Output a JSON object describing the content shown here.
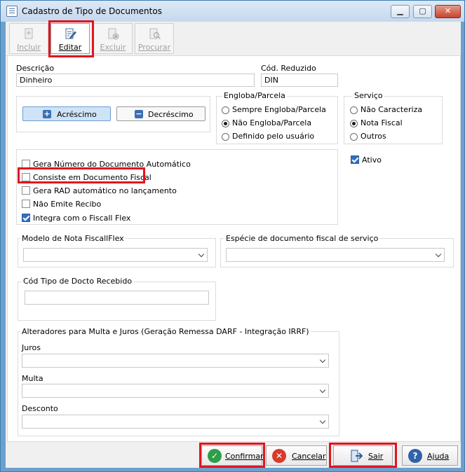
{
  "window": {
    "title": "Cadastro de Tipo de Documentos",
    "minimize": "▁",
    "maximize": "▢",
    "close": "✕"
  },
  "toolbar": {
    "incluir": "Incluir",
    "editar": "Editar",
    "excluir": "Excluir",
    "procurar": "Procurar"
  },
  "form": {
    "descricao_label": "Descrição",
    "descricao_value": "Dinheiro",
    "cod_reduzido_label": "Cód. Reduzido",
    "cod_reduzido_value": "DIN",
    "acrescimo": "Acréscimo",
    "decrescimo": "Decréscimo",
    "engloba": {
      "label": "Engloba/Parcela",
      "options": [
        "Sempre Engloba/Parcela",
        "Não Engloba/Parcela",
        "Definido pelo usuário"
      ],
      "selected": "Não Engloba/Parcela"
    },
    "servico": {
      "label": "Serviço",
      "options": [
        "Não Caracteriza",
        "Nota Fiscal",
        "Outros"
      ],
      "selected": "Nota Fiscal"
    },
    "ativo": "Ativo",
    "checks": [
      {
        "label": "Gera Número do Documento Automático",
        "checked": false
      },
      {
        "label": "Consiste em Documento Fiscal",
        "checked": false
      },
      {
        "label": "Gera RAD automático no lançamento",
        "checked": false
      },
      {
        "label": "Não Emite Recibo",
        "checked": false
      },
      {
        "label": "Integra com o Fiscall Flex",
        "checked": true
      }
    ],
    "modelo_nota_label": "Modelo de Nota FiscallFlex",
    "especie_label": "Espécie de documento fiscal de serviço",
    "cod_tipo_label": "Cód Tipo de Docto Recebido",
    "alteradores_label": "Alteradores para Multa e Juros (Geração Remessa DARF - Integração IRRF)",
    "juros_label": "Juros",
    "multa_label": "Multa",
    "desconto_label": "Desconto"
  },
  "buttons": {
    "confirmar": "Confirmar",
    "cancelar": "Cancelar",
    "sair": "Sair",
    "ajuda": "Ajuda"
  },
  "colors": {
    "highlight": "#e0141e",
    "accent": "#2f6fbf",
    "confirm": "#2e9e4a",
    "cancel": "#d63b2c"
  }
}
